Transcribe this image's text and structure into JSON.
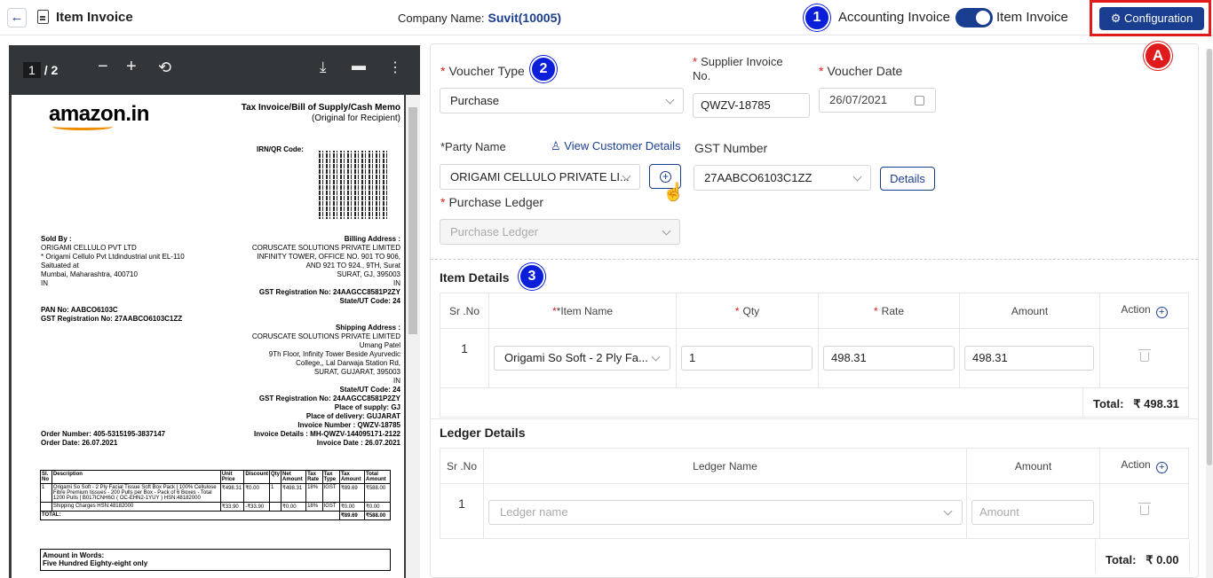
{
  "header": {
    "title": "Item Invoice",
    "company_label": "Company Name:",
    "company_value": "Suvit(10005)",
    "toggle_left": "Accounting Invoice",
    "toggle_right": "Item Invoice",
    "config_label": "Configuration",
    "badge1": "1",
    "badge2": "2",
    "badge3": "3",
    "badgeA": "A"
  },
  "pdf": {
    "page_current": "1",
    "page_sep": "/",
    "page_total": "2",
    "title": "Tax Invoice/Bill of Supply/Cash Memo",
    "subtitle": "(Original for Recipient)",
    "irn": "IRN/QR Code:",
    "sold_by": [
      "Sold By :",
      "ORIGAMI CELLULO PVT LTD",
      "* Origami Cellulo Pvt Ltdindustrial unit EL-110",
      "Saituated at",
      "Mumbai, Maharashtra, 400710",
      "IN"
    ],
    "pan": [
      "PAN No: AABCO6103C",
      "GST Registration No: 27AABCO6103C1ZZ"
    ],
    "billing": [
      "Billing Address :",
      "CORUSCATE SOLUTIONS PRIVATE LIMITED",
      "INFINITY TOWER, OFFICE NO. 901 TO 906,",
      "AND 921 TO 924., 9TH, Surat",
      "SURAT, GJ, 395003",
      "IN",
      "GST Registration No: 24AAGCC8581P2ZY",
      "State/UT Code: 24"
    ],
    "shipping": [
      "Shipping Address :",
      "CORUSCATE SOLUTIONS PRIVATE LIMITED",
      "Umang Patel",
      "9Th Floor, Infinity Tower Beside Ayurvedic",
      "College,, Lal Darwaja Station Rd,",
      "SURAT, GUJARAT, 395003",
      "IN",
      "State/UT Code: 24",
      "GST Registration No: 24AAGCC8581P2ZY",
      "Place of supply: GJ",
      "Place of delivery: GUJARAT",
      "Invoice Number : QWZV-18785",
      "Invoice Details : MH-QWZV-144095171-2122",
      "Invoice Date : 26.07.2021"
    ],
    "order": [
      "Order Number: 405-5315195-3837147",
      "Order Date: 26.07.2021"
    ],
    "table_head": [
      "Sl. No",
      "Description",
      "Unit Price",
      "Discount",
      "Qty",
      "Net Amount",
      "Tax Rate",
      "Tax Type",
      "Tax Amount",
      "Total Amount"
    ],
    "row1": [
      "1",
      "Origami So Soft - 2 Ply Facial Tissue Soft Box Pack | 100% Cellulose Fibre Premium tissues - 200 Pulls per Box - Pack of 6 Boxes - Total 1200 Pulls | B017ICNH6G ( OC-EHN2-1YUY ) HSN:48182000",
      "₹498.31",
      "₹0.00",
      "1",
      "₹498.31",
      "18%",
      "IGST",
      "₹89.69",
      "₹588.00"
    ],
    "row2": [
      "",
      "Shipping Charges HSN:48182000",
      "₹33.90",
      "-₹33.90",
      "",
      "₹0.00",
      "18%",
      "IGST",
      "₹0.00",
      "₹0.00"
    ],
    "total_row": [
      "TOTAL:",
      "₹89.69",
      "₹588.00"
    ],
    "words_label": "Amount in Words:",
    "words_value": "Five Hundred Eighty-eight only"
  },
  "form": {
    "voucher_type_label": "Voucher Type",
    "voucher_type_value": "Purchase",
    "supplier_label": "Supplier Invoice No.",
    "supplier_value": "QWZV-18785",
    "date_label": "Voucher Date",
    "date_value": "26/07/2021",
    "party_label": "*Party Name",
    "view_customer": "View Customer Details",
    "party_value": "ORIGAMI CELLULO PRIVATE LI...",
    "gst_label": "GST Number",
    "gst_value": "27AABCO6103C1ZZ",
    "details_btn": "Details",
    "ledger_label": "Purchase Ledger",
    "ledger_placeholder": "Purchase Ledger"
  },
  "item_details": {
    "title": "Item Details",
    "cols": [
      "Sr .No",
      "*Item Name",
      "Qty",
      "Rate",
      "Amount",
      "Action"
    ],
    "rows": [
      {
        "sr": "1",
        "item": "Origami So Soft - 2 Ply Fa...",
        "qty": "1",
        "rate": "498.31",
        "amount": "498.31"
      }
    ],
    "total_label": "Total:",
    "total_value": "₹ 498.31"
  },
  "ledger_details": {
    "title": "Ledger Details",
    "cols": [
      "Sr .No",
      "Ledger Name",
      "Amount",
      "Action"
    ],
    "rows": [
      {
        "sr": "1",
        "ledger_placeholder": "Ledger name",
        "amount_placeholder": "Amount"
      }
    ],
    "total_label": "Total:",
    "total_value": "₹ 0.00"
  }
}
